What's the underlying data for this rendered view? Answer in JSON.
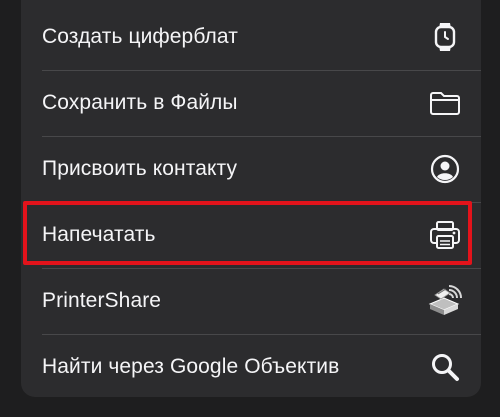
{
  "menu": {
    "items": [
      {
        "label": "Создать циферблат",
        "icon": "watch-icon"
      },
      {
        "label": "Сохранить в Файлы",
        "icon": "folder-icon"
      },
      {
        "label": "Присвоить контакту",
        "icon": "contact-icon"
      },
      {
        "label": "Напечатать",
        "icon": "printer-icon",
        "highlighted": true
      },
      {
        "label": "PrinterShare",
        "icon": "printershare-app-icon"
      },
      {
        "label": "Найти через Google Объектив",
        "icon": "search-icon"
      }
    ]
  },
  "colors": {
    "menu_background": "#2c2c2e",
    "text": "#f5f5f7",
    "highlight_border": "#e3131b"
  }
}
